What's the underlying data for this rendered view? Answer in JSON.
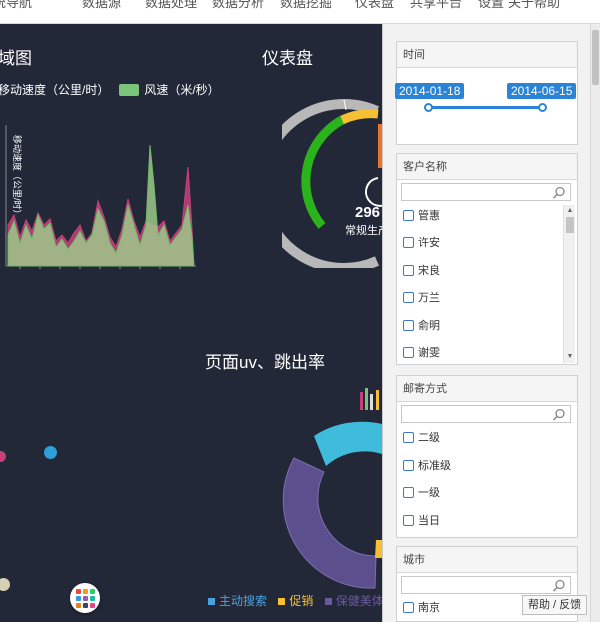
{
  "nav": {
    "items": [
      "系统导航",
      "数据源",
      "数据处理",
      "数据分析",
      "数据挖掘",
      "仪表盘",
      "共享平台",
      "设置",
      "关于帮助"
    ]
  },
  "charts": {
    "area": {
      "title": "域图",
      "legend_series1": "移动速度（公里/时）",
      "legend_series2": "风速（米/秒）",
      "ylabel": "移动速度（公里/时）"
    },
    "gauge": {
      "title": "仪表盘",
      "value_text": "296",
      "label": "常规生产"
    },
    "donut": {
      "title": "页面uv、跳出率"
    },
    "bottom_legend": [
      {
        "label": "主动搜索",
        "color": "#4aa3df"
      },
      {
        "label": "促销",
        "color": "#f5c034"
      },
      {
        "label": "保健美体",
        "color": "#6a5a9c"
      }
    ]
  },
  "filters": {
    "time": {
      "title": "时间",
      "start": "2014-01-18",
      "end": "2014-06-15"
    },
    "customer": {
      "title": "客户名称",
      "search_placeholder": "",
      "options": [
        "管惠",
        "许安",
        "宋良",
        "万兰",
        "俞明",
        "谢雯"
      ]
    },
    "mail": {
      "title": "邮寄方式",
      "search_placeholder": "",
      "options": [
        "二级",
        "标准级",
        "一级",
        "当日"
      ]
    },
    "city": {
      "title": "城市",
      "search_placeholder": "",
      "options": [
        "南京"
      ]
    }
  },
  "help_label": "帮助 / 反馈",
  "colors": {
    "background": "#232838",
    "accent": "#2b83d5",
    "green_area": "#7cc37a",
    "pink_area": "#c8407a",
    "gauge_green": "#2bb31b",
    "gauge_yellow": "#f5c034",
    "gauge_orange": "#e8742f"
  }
}
